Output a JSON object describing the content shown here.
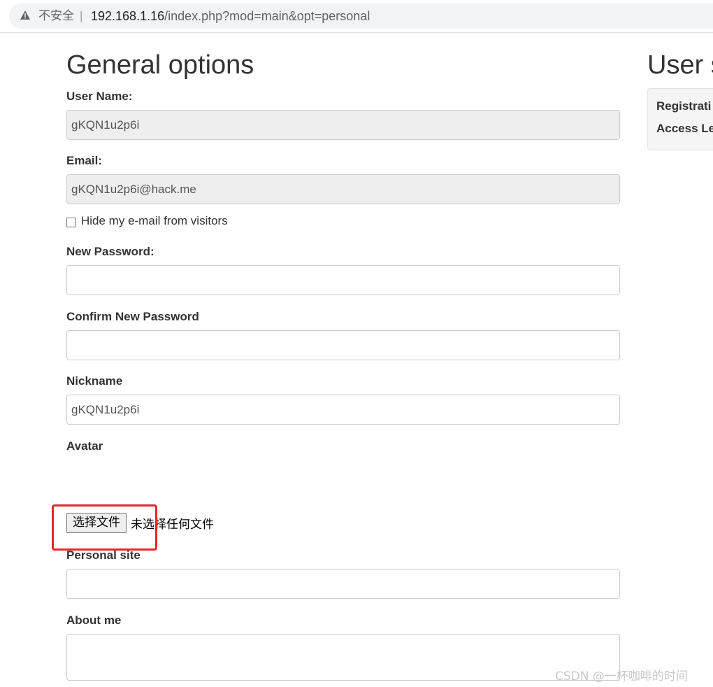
{
  "browser": {
    "security_label": "不安全",
    "separator": "|",
    "url_host": "192.168.1.16",
    "url_path": "/index.php?mod=main&opt=personal"
  },
  "form": {
    "title": "General options",
    "username_label": "User Name:",
    "username_value": "gKQN1u2p6i",
    "email_label": "Email:",
    "email_value": "gKQN1u2p6i@hack.me",
    "hide_email_label": "Hide my e-mail from visitors",
    "hide_email_checked": false,
    "new_password_label": "New Password:",
    "new_password_value": "",
    "confirm_password_label": "Confirm New Password",
    "confirm_password_value": "",
    "nickname_label": "Nickname",
    "nickname_value": "gKQN1u2p6i",
    "avatar_label": "Avatar",
    "file_button_label": "选择文件",
    "file_status": "未选择任何文件",
    "personal_site_label": "Personal site",
    "personal_site_value": "",
    "about_me_label": "About me",
    "about_me_value": ""
  },
  "side": {
    "title": "User s",
    "registration_label": "Registrati",
    "access_level_label": "Access Le"
  },
  "watermark": "CSDN @一杯咖啡的时间",
  "colors": {
    "highlight": "#e8262a",
    "readonly_bg": "#eeeeee",
    "panel_bg": "#f5f5f5"
  },
  "icons": {
    "security": "warning-triangle-icon"
  }
}
